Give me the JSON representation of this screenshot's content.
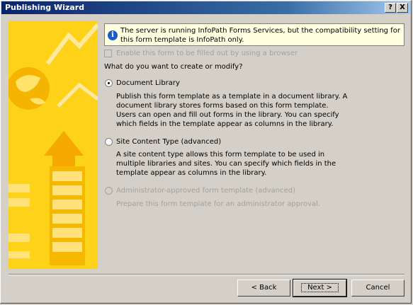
{
  "window": {
    "title": "Publishing Wizard",
    "help_label": "?",
    "close_label": "X"
  },
  "info": {
    "icon": "info-icon",
    "icon_glyph": "i",
    "text": "The server is running InfoPath Forms Services, but the compatibility setting for this form template is InfoPath only."
  },
  "browser_checkbox": {
    "label": "Enable this form to be filled out by using a browser",
    "checked": false,
    "enabled": false
  },
  "question": "What do you want to create or modify?",
  "options": [
    {
      "label": "Document Library",
      "selected": true,
      "enabled": true,
      "description": "Publish this form template as a template in a document library. A document library stores forms based on this form template. Users can open and fill out forms in the library. You can specify which fields in the template appear as columns in the library."
    },
    {
      "label": "Site Content Type (advanced)",
      "selected": false,
      "enabled": true,
      "description": "A site content type allows this form template to be used in multiple libraries and sites. You can specify which fields in the template appear as columns in the library."
    },
    {
      "label": "Administrator-approved form template (advanced)",
      "selected": false,
      "enabled": false,
      "description": "Prepare this form template for an administrator approval."
    }
  ],
  "buttons": {
    "back": "< Back",
    "next": "Next >",
    "cancel": "Cancel"
  },
  "colors": {
    "banner": "#ffd21a",
    "title_bar_start": "#0a246a",
    "info_background": "#ffffe1"
  }
}
